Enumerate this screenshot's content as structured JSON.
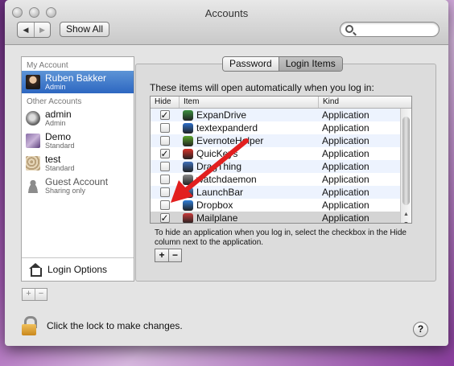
{
  "window": {
    "title": "Accounts"
  },
  "toolbar": {
    "back": "◀",
    "forward": "▶",
    "show_all": "Show All",
    "search_placeholder": ""
  },
  "sidebar": {
    "my_account_header": "My Account",
    "my_account": {
      "name": "Ruben Bakker",
      "role": "Admin"
    },
    "other_header": "Other Accounts",
    "others": [
      {
        "name": "admin",
        "role": "Admin"
      },
      {
        "name": "Demo",
        "role": "Standard"
      },
      {
        "name": "test",
        "role": "Standard"
      },
      {
        "name": "Guest Account",
        "role": "Sharing only"
      }
    ],
    "login_options": "Login Options",
    "add": "+",
    "remove": "−"
  },
  "tabs": {
    "password": "Password",
    "login_items": "Login Items",
    "active": "login_items"
  },
  "login_items": {
    "intro": "These items will open automatically when you log in:",
    "columns": {
      "hide": "Hide",
      "item": "Item",
      "kind": "Kind"
    },
    "rows": [
      {
        "hide": true,
        "name": "ExpanDrive",
        "kind": "Application",
        "icon": "expandrive-icon",
        "color": "#3a8f3e"
      },
      {
        "hide": false,
        "name": "textexpanderd",
        "kind": "Application",
        "icon": "textexpander-icon",
        "color": "#2d6ec9"
      },
      {
        "hide": false,
        "name": "EvernoteHelper",
        "kind": "Application",
        "icon": "evernote-icon",
        "color": "#5aa42b"
      },
      {
        "hide": true,
        "name": "QuicKeys",
        "kind": "Application",
        "icon": "quickeys-icon",
        "color": "#d9332a"
      },
      {
        "hide": false,
        "name": "DragThing",
        "kind": "Application",
        "icon": "dragthing-icon",
        "color": "#3d6fb8"
      },
      {
        "hide": false,
        "name": "watchdaemon",
        "kind": "Application",
        "icon": "watchdaemon-icon",
        "color": "#8a8a8a"
      },
      {
        "hide": false,
        "name": "LaunchBar",
        "kind": "Application",
        "icon": "launchbar-icon",
        "color": "#4a80c8"
      },
      {
        "hide": false,
        "name": "Dropbox",
        "kind": "Application",
        "icon": "dropbox-icon",
        "color": "#2f7ed8"
      },
      {
        "hide": true,
        "name": "Mailplane",
        "kind": "Application",
        "icon": "mailplane-icon",
        "color": "#c83a3a"
      }
    ],
    "help": "To hide an application when you log in, select the checkbox in the Hide column next to the application.",
    "add": "+",
    "remove": "−"
  },
  "footer": {
    "lock_text": "Click the lock to make changes.",
    "help": "?"
  },
  "colors": {
    "selection": "#3470c6",
    "annotation_arrow": "#e21f1f"
  }
}
